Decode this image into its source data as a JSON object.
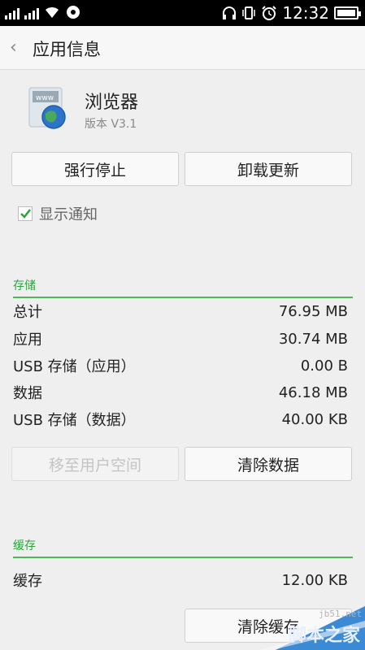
{
  "statusbar": {
    "time": "12:32",
    "icons": [
      "signal-icon",
      "signal2-icon",
      "wifi-icon",
      "chat-icon",
      "headset-icon",
      "vibrate-icon",
      "alarm-icon",
      "battery-icon"
    ]
  },
  "header": {
    "back_icon": "‹",
    "title": "应用信息"
  },
  "app": {
    "icon": "browser-globe-icon",
    "name": "浏览器",
    "version": "版本 V3.1"
  },
  "actions": {
    "force_stop": "强行停止",
    "uninstall_updates": "卸载更新"
  },
  "notifications": {
    "label": "显示通知",
    "checked": true
  },
  "storage": {
    "heading": "存储",
    "rows": [
      {
        "label": "总计",
        "value": "76.95 MB"
      },
      {
        "label": "应用",
        "value": "30.74 MB"
      },
      {
        "label": "USB 存储（应用）",
        "value": "0.00 B"
      },
      {
        "label": "数据",
        "value": "46.18 MB"
      },
      {
        "label": "USB 存储（数据）",
        "value": "40.00 KB"
      }
    ],
    "move_label": "移至用户空间",
    "clear_data_label": "清除数据"
  },
  "cache": {
    "heading": "缓存",
    "rows": [
      {
        "label": "缓存",
        "value": "12.00 KB"
      }
    ],
    "clear_cache_label": "清除缓存"
  },
  "watermark": {
    "url": "jb51.net",
    "text": "脚本之家"
  },
  "colors": {
    "accent": "#2ba43f",
    "statusbar": "#000000"
  }
}
